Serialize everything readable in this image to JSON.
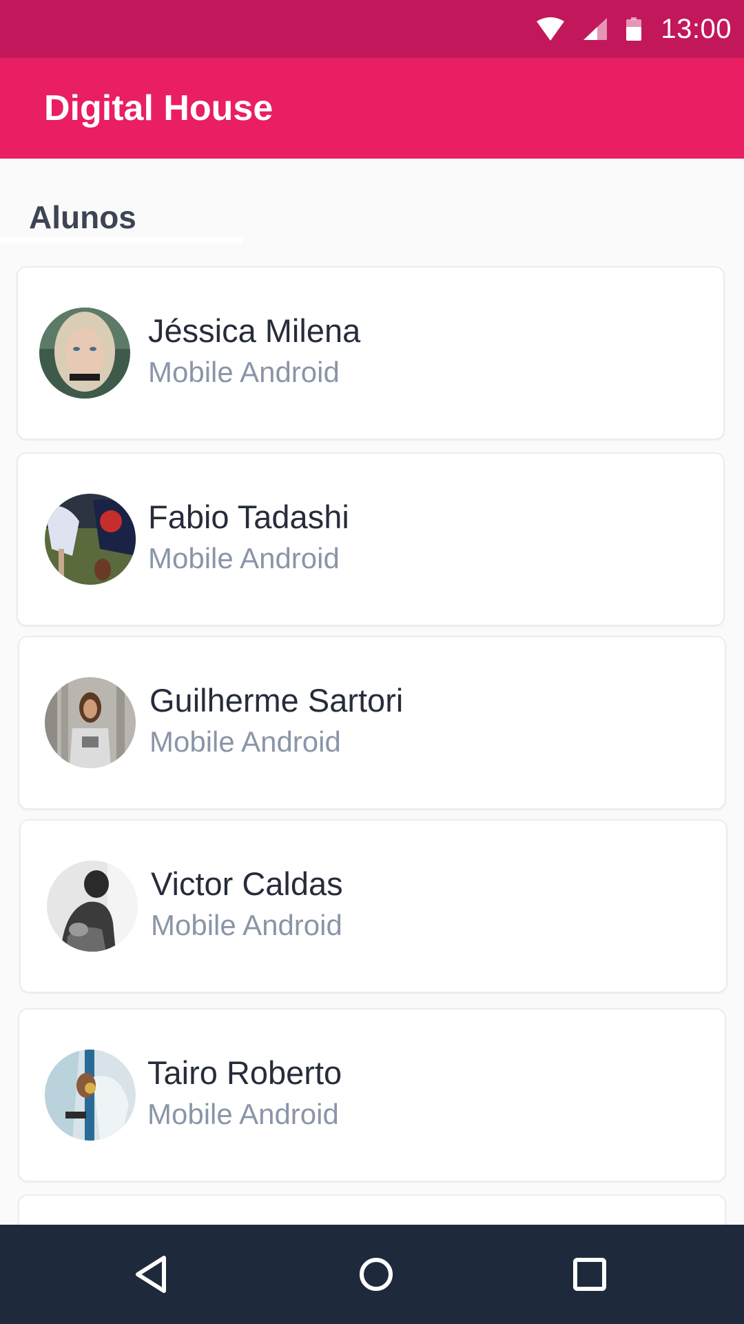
{
  "status_bar": {
    "time": "13:00",
    "icons": [
      "wifi-icon",
      "signal-icon",
      "battery-icon"
    ]
  },
  "app_bar": {
    "title": "Digital House"
  },
  "section": {
    "title": "Alunos"
  },
  "students": [
    {
      "name": "Jéssica Milena",
      "course": "Mobile Android",
      "avatar": "student-photo"
    },
    {
      "name": "Fabio Tadashi",
      "course": "Mobile Android",
      "avatar": "student-photo"
    },
    {
      "name": "Guilherme Sartori",
      "course": "Mobile Android",
      "avatar": "student-photo"
    },
    {
      "name": "Victor Caldas",
      "course": "Mobile Android",
      "avatar": "student-photo"
    },
    {
      "name": "Tairo Roberto",
      "course": "Mobile Android",
      "avatar": "student-photo"
    }
  ],
  "nav_bar": {
    "icons": [
      "back-icon",
      "home-icon",
      "recents-icon"
    ]
  },
  "colors": {
    "status_bar": "#c2185b",
    "app_bar": "#e91e63",
    "nav_bar": "#1e2a3c",
    "name_text": "#262c3a",
    "course_text": "#8a95a8"
  }
}
